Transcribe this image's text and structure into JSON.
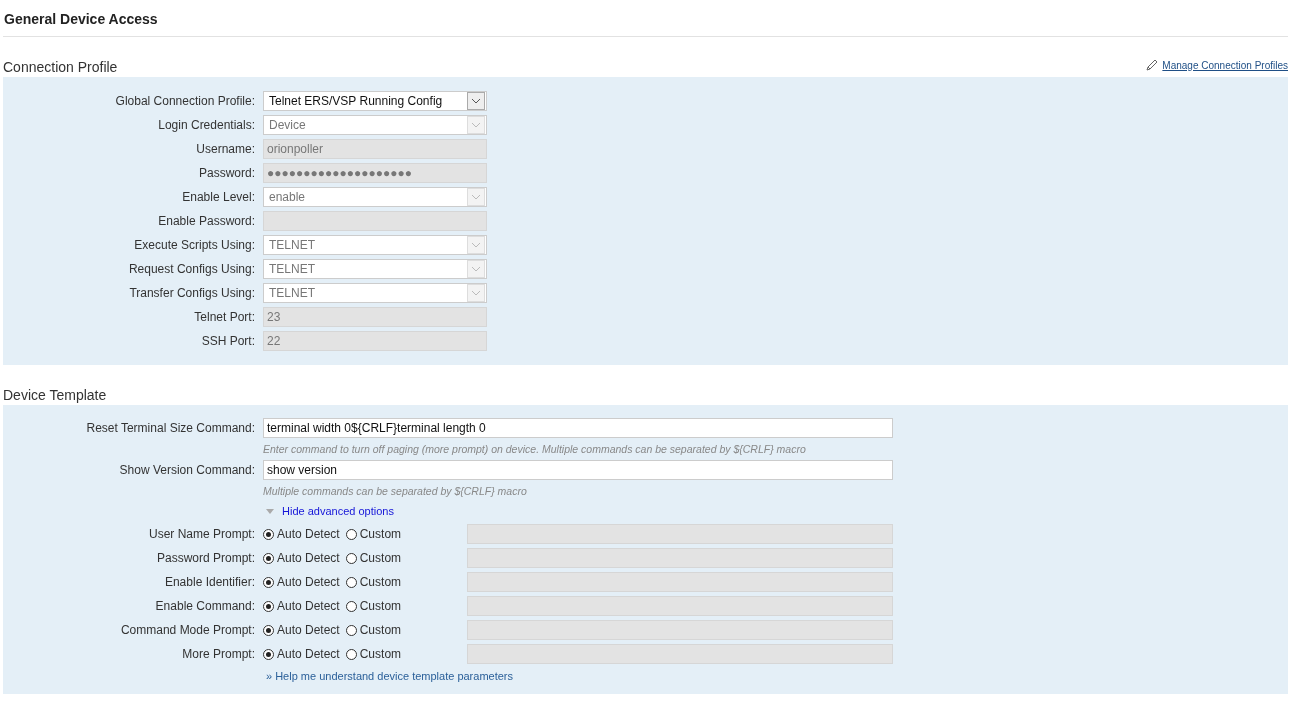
{
  "page_title": "General Device Access",
  "connection_profile": {
    "title": "Connection Profile",
    "manage_link": "Manage Connection Profiles",
    "fields": [
      {
        "label": "Global Connection Profile:",
        "kind": "select",
        "value": "Telnet ERS/VSP Running Config",
        "disabled": false
      },
      {
        "label": "Login Credentials:",
        "kind": "select",
        "value": "Device",
        "disabled": true
      },
      {
        "label": "Username:",
        "kind": "text",
        "value": "orionpoller",
        "disabled": true
      },
      {
        "label": "Password:",
        "kind": "text",
        "value": "●●●●●●●●●●●●●●●●●●●●",
        "disabled": true
      },
      {
        "label": "Enable Level:",
        "kind": "select",
        "value": "enable",
        "disabled": true
      },
      {
        "label": "Enable Password:",
        "kind": "text",
        "disabled": true
      },
      {
        "label": "Execute Scripts Using:",
        "kind": "select",
        "value": "TELNET",
        "disabled": true
      },
      {
        "label": "Request Configs Using:",
        "kind": "select",
        "value": "TELNET",
        "disabled": true
      },
      {
        "label": "Transfer Configs Using:",
        "kind": "select",
        "value": "TELNET",
        "disabled": true
      },
      {
        "label": "Telnet Port:",
        "kind": "text",
        "value": "23",
        "disabled": true
      },
      {
        "label": "SSH Port:",
        "kind": "text",
        "value": "22",
        "disabled": true
      }
    ]
  },
  "device_template": {
    "title": "Device Template",
    "commands": [
      {
        "label": "Reset Terminal Size Command:",
        "value": "terminal width 0${CRLF}terminal length 0",
        "hint": "Enter command to turn off paging (more prompt) on device. Multiple commands can be separated by ${CRLF} macro"
      },
      {
        "label": "Show Version Command:",
        "value": "show version",
        "hint": "Multiple commands can be separated by ${CRLF} macro"
      }
    ],
    "advanced_toggle": {
      "label": "Hide advanced options",
      "expanded": true
    },
    "prompts": [
      {
        "label": "User Name Prompt:",
        "options": [
          {
            "label": "Auto Detect",
            "selected": true
          },
          {
            "label": "Custom",
            "selected": false
          }
        ]
      },
      {
        "label": "Password Prompt:",
        "options": [
          {
            "label": "Auto Detect",
            "selected": true
          },
          {
            "label": "Custom",
            "selected": false
          }
        ]
      },
      {
        "label": "Enable Identifier:",
        "options": [
          {
            "label": "Auto Detect",
            "selected": true
          },
          {
            "label": "Custom",
            "selected": false
          }
        ]
      },
      {
        "label": "Enable Command:",
        "options": [
          {
            "label": "Auto Detect",
            "selected": true
          },
          {
            "label": "Custom",
            "selected": false
          }
        ]
      },
      {
        "label": "Command Mode Prompt:",
        "options": [
          {
            "label": "Auto Detect",
            "selected": true
          },
          {
            "label": "Custom",
            "selected": false
          }
        ]
      },
      {
        "label": "More Prompt:",
        "options": [
          {
            "label": "Auto Detect",
            "selected": true
          },
          {
            "label": "Custom",
            "selected": false
          }
        ]
      }
    ],
    "help_link": "» Help me understand device template parameters"
  }
}
